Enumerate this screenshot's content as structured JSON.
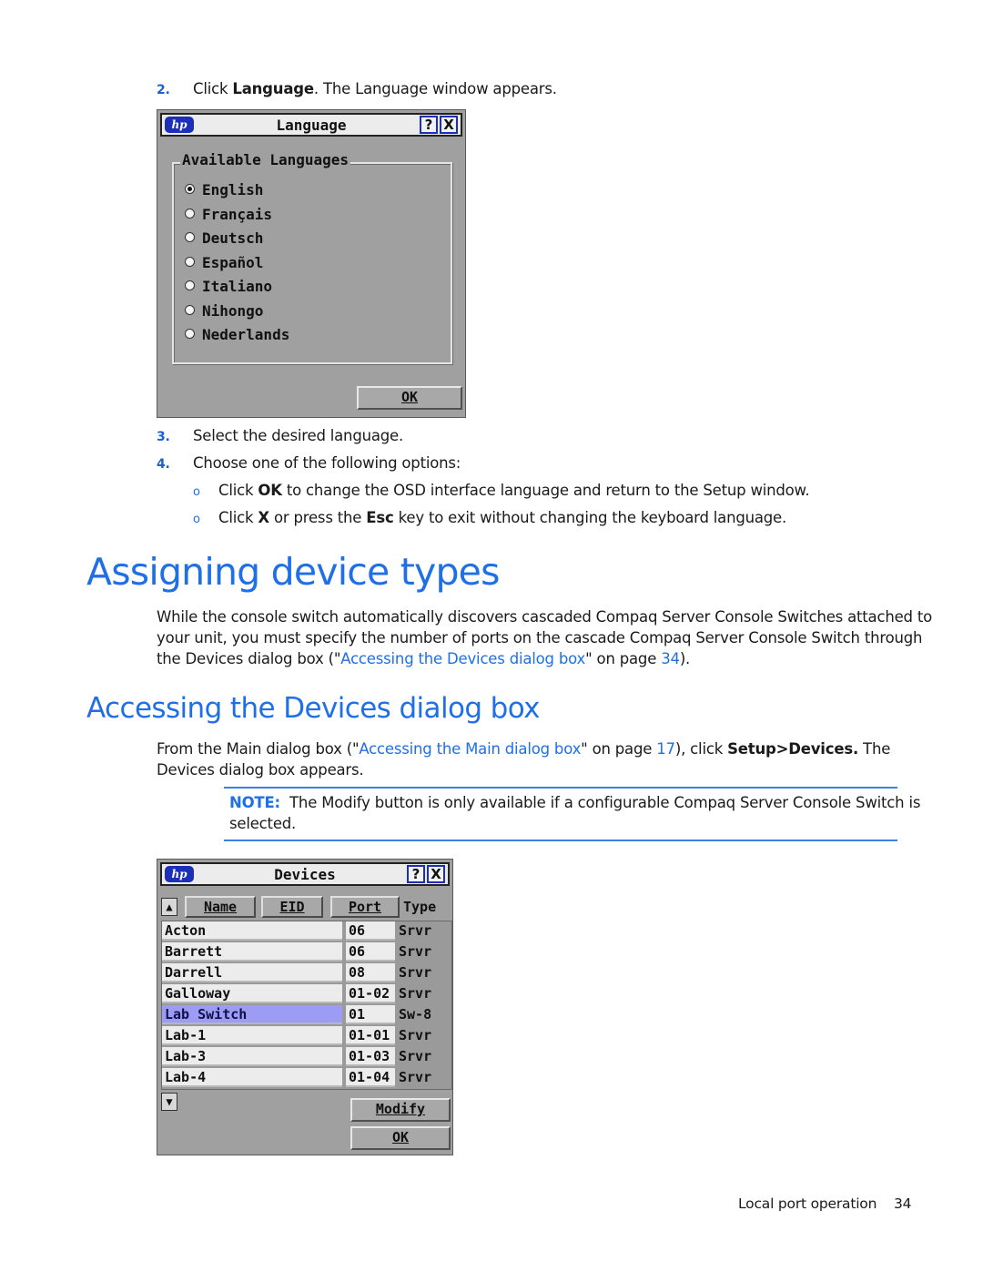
{
  "steps_top": [
    {
      "num": "2.",
      "pre": "Click ",
      "bold": "Language",
      "post": ". The Language window appears."
    }
  ],
  "language_dialog": {
    "title": "Language",
    "help_button": "?",
    "close_button": "X",
    "logo": "hp",
    "group_label": "Available Languages",
    "options": [
      {
        "label": "English",
        "selected": true
      },
      {
        "label": "Français",
        "selected": false
      },
      {
        "label": "Deutsch",
        "selected": false
      },
      {
        "label": "Español",
        "selected": false
      },
      {
        "label": "Italiano",
        "selected": false
      },
      {
        "label": "Nihongo",
        "selected": false
      },
      {
        "label": "Nederlands",
        "selected": false
      }
    ],
    "ok_button": "OK"
  },
  "steps_after": [
    {
      "num": "3.",
      "text": "Select the desired language."
    },
    {
      "num": "4.",
      "text": "Choose one of the following options:"
    }
  ],
  "options_list": [
    {
      "bullet": "o",
      "p1": "Click ",
      "b1": "OK",
      "p2": " to change the OSD interface language and return to the Setup window.",
      "b2": "",
      "p3": ""
    },
    {
      "bullet": "o",
      "p1": "Click ",
      "b1": "X",
      "p2": " or press the ",
      "b2": "Esc",
      "p3": " key to exit without changing the keyboard language."
    }
  ],
  "section1": {
    "heading": "Assigning device types",
    "para_line1": "While the console switch automatically discovers cascaded Compaq Server Console Switches attached to",
    "para_line2": "your unit, you must specify the number of ports on the cascade Compaq Server Console Switch through",
    "para_line3_pre": "the Devices dialog box (\"",
    "para_line3_link": "Accessing the Devices dialog box",
    "para_line3_mid": "\" on page ",
    "para_line3_page": "34",
    "para_line3_post": ")."
  },
  "section2": {
    "heading": "Accessing the Devices dialog box",
    "line1_pre": "From the Main dialog box (\"",
    "line1_link": "Accessing the Main dialog box",
    "line1_mid": "\" on page ",
    "line1_page": "17",
    "line1_post1": "), click ",
    "line1_bold": "Setup>Devices.",
    "line1_post2": " The",
    "line2": "Devices dialog box appears.",
    "note_label": "NOTE:",
    "note_line1": "  The Modify button is only available if a configurable Compaq Server Console Switch is",
    "note_line2": "selected."
  },
  "devices_dialog": {
    "title": "Devices",
    "help_button": "?",
    "close_button": "X",
    "logo": "hp",
    "columns": {
      "name": "Name",
      "eid": "EID",
      "port": "Port",
      "type": "Type"
    },
    "scroll_up": "▲",
    "scroll_down": "▼",
    "rows": [
      {
        "name": "Acton",
        "port": "06",
        "type": "Srvr",
        "selected": false
      },
      {
        "name": "Barrett",
        "port": "06",
        "type": "Srvr",
        "selected": false
      },
      {
        "name": "Darrell",
        "port": "08",
        "type": "Srvr",
        "selected": false
      },
      {
        "name": "Galloway",
        "port": "01-02",
        "type": "Srvr",
        "selected": false
      },
      {
        "name": "Lab Switch",
        "port": "01",
        "type": "Sw-8",
        "selected": true
      },
      {
        "name": "Lab-1",
        "port": "01-01",
        "type": "Srvr",
        "selected": false
      },
      {
        "name": "Lab-3",
        "port": "01-03",
        "type": "Srvr",
        "selected": false
      },
      {
        "name": "Lab-4",
        "port": "01-04",
        "type": "Srvr",
        "selected": false
      }
    ],
    "modify_button": "Modify",
    "ok_button": "OK"
  },
  "footer": {
    "section": "Local port operation",
    "page": "34"
  }
}
